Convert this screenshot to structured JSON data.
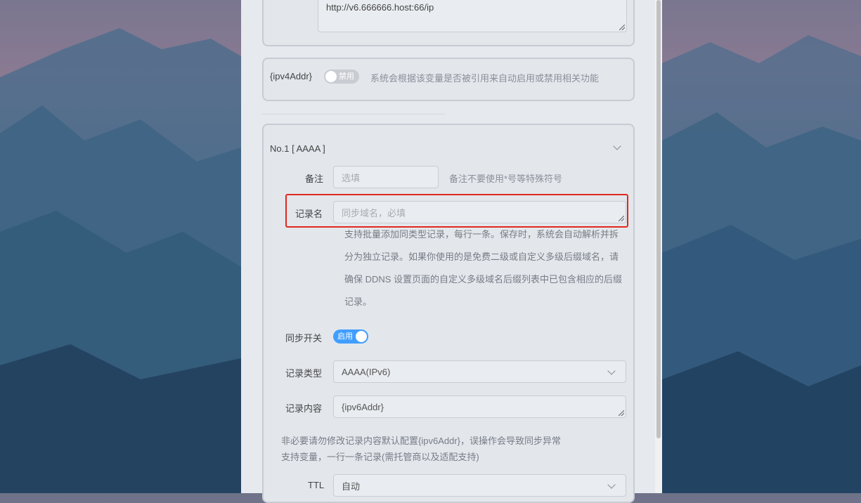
{
  "callback_url": {
    "value": "http://v6.666666.host:66/ip"
  },
  "ipv4_var": {
    "label": "{ipv4Addr}",
    "switch_label": "禁用",
    "hint": "系统会根据该变量是否被引用来自动启用或禁用相关功能"
  },
  "record": {
    "header": "No.1 [ AAAA ]",
    "remark": {
      "label": "备注",
      "placeholder": "选填",
      "hint": "备注不要使用*号等特殊符号"
    },
    "name": {
      "label": "记录名",
      "placeholder": "同步域名，必填",
      "description": [
        "支持批量添加同类型记录，每行一条。保存时，系统会自动解析并拆",
        "分为独立记录。如果你使用的是免费二级或自定义多级后缀域名，请",
        "确保 DDNS 设置页面的自定义多级域名后缀列表中已包含相应的后缀",
        "记录。"
      ]
    },
    "sync_switch": {
      "label": "同步开关",
      "state_label": "启用"
    },
    "type": {
      "label": "记录类型",
      "value": "AAAA(IPv6)"
    },
    "content": {
      "label": "记录内容",
      "value": "{ipv6Addr}",
      "note1": "非必要请勿修改记录内容默认配置{ipv6Addr}，误操作会导致同步异常",
      "note2": "支持变量，一行一条记录(需托管商以及适配支持)"
    },
    "ttl": {
      "label": "TTL",
      "value": "自动"
    }
  },
  "colors": {
    "accent": "#409eff",
    "highlight": "#e0281e"
  }
}
